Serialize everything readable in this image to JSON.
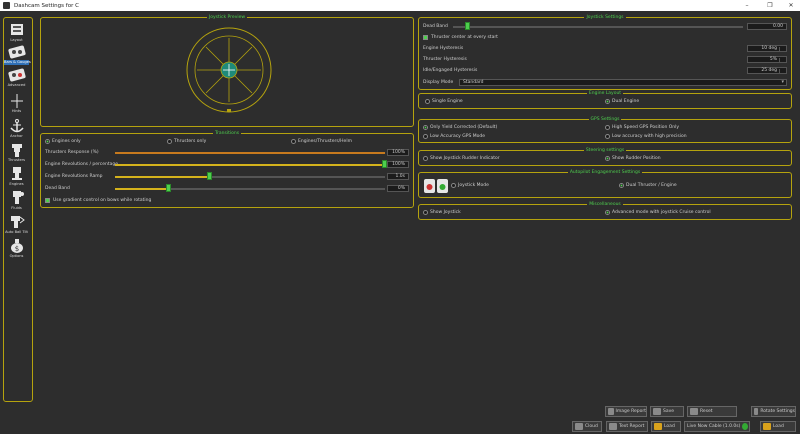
{
  "window": {
    "title": "Dashcam Settings for C",
    "controls": [
      "–",
      "❐",
      "✕"
    ]
  },
  "sidebar": {
    "items": [
      {
        "label": "Layout",
        "icon": "layout-icon"
      },
      {
        "label": "Bars & Gauges",
        "icon": "gauges-icon"
      },
      {
        "label": "Advanced",
        "icon": "advanced-icon"
      },
      {
        "label": "Hints",
        "icon": "hints-icon"
      },
      {
        "label": "Anchor",
        "icon": "anchor-icon"
      },
      {
        "label": "Thrusters",
        "icon": "thrusters-icon"
      },
      {
        "label": "Engines",
        "icon": "engines-icon"
      },
      {
        "label": "Fluids",
        "icon": "fluids-icon"
      },
      {
        "label": "Auto Ball Tilt",
        "icon": "tilt-icon"
      },
      {
        "label": "Options",
        "icon": "money-icon"
      }
    ],
    "selected": 1
  },
  "joystick": {
    "title": "Joystick Preview"
  },
  "transitions": {
    "title": "Transitions",
    "modes": [
      "Engines only",
      "Thrusters only",
      "Engines/Thrusters/Helm"
    ],
    "mode_selected": 0,
    "sliders": [
      {
        "label": "Thrusters Response (%)",
        "value": "100%",
        "level": 1.0,
        "color": "orange"
      },
      {
        "label": "Engine Revolutions / percentage",
        "value": "100%",
        "level": 1.0,
        "color": "yellow"
      },
      {
        "label": "Engine Revolutions Ramp",
        "value": "1.0s",
        "level": 0.35,
        "color": "yellow"
      },
      {
        "label": "Dead Band",
        "value": "0%",
        "level": 0.2,
        "color": "yellow"
      }
    ],
    "checkbox_label": "Use gradient control on bows while rotating",
    "checkbox_checked": true
  },
  "joystick_settings": {
    "title": "Joystick Settings",
    "dead_band_label": "Dead Band",
    "dead_band_value": "0.00",
    "dead_band_level": 0.05,
    "center_check_label": "Thruster center at every start",
    "center_check_checked": true,
    "fields": [
      {
        "label": "Engine Hysteresis",
        "value": "10 deg"
      },
      {
        "label": "Thruster Hysteresis",
        "value": "5%"
      },
      {
        "label": "Idle/Engaged Hysteresis",
        "value": "25 deg"
      }
    ],
    "combo_label": "Display Mode",
    "combo_value": "Standard"
  },
  "engine_layout": {
    "title": "Engine Layout",
    "options": [
      "Single Engine",
      "Dual Engine"
    ],
    "selected": 1
  },
  "gps_settings": {
    "title": "GPS Settings",
    "options": [
      "Only Yield Corrected (Default)",
      "High Speed GPS Position Only",
      "Low Accuracy GPS Mode",
      "Low accuracy with high precision"
    ],
    "selected": 0
  },
  "steering_settings": {
    "title": "Steering settings",
    "options": [
      "Show Joystick Rudder Indicator",
      "Show Rudder Position"
    ],
    "selected": 1
  },
  "autopilot": {
    "title": "Autopilot Engagement Settings",
    "options": [
      "Joystick Mode",
      "Dual Thruster / Engine"
    ],
    "selected": 1
  },
  "misc": {
    "title": "Miscellaneous",
    "options": [
      "Show Joystick",
      "Advanced mode with joystick Cruise control"
    ],
    "selected": 1
  },
  "buttons": {
    "row1": [
      "Image Report",
      "Save",
      "Reset",
      "Rotate Settings"
    ],
    "row2": [
      "Cloud",
      "Text Report",
      "Load",
      "Live Now Cable (1.0.0s)",
      "Load"
    ]
  },
  "colors": {
    "accent_border": "#b5a30e",
    "accent_text": "#4ecf4e",
    "background": "#2d2d2d"
  }
}
